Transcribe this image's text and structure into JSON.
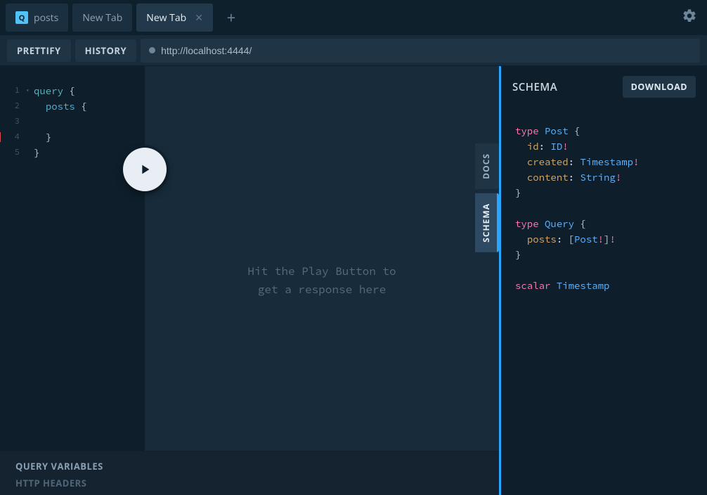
{
  "tabs": [
    {
      "badge": "Q",
      "label": "posts",
      "active": false,
      "closeable": false
    },
    {
      "badge": "",
      "label": "New Tab",
      "active": false,
      "closeable": false
    },
    {
      "badge": "",
      "label": "New Tab",
      "active": true,
      "closeable": true
    }
  ],
  "toolbar": {
    "prettify": "PRETTIFY",
    "history": "HISTORY",
    "url": "http://localhost:4444/"
  },
  "editor": {
    "lines": [
      {
        "n": "1",
        "fold": true,
        "err": false,
        "html": "<span class='kw-query'>query</span> <span class='brace'>{</span>"
      },
      {
        "n": "2",
        "fold": false,
        "err": false,
        "html": "  <span class='kw-field'>posts</span> <span class='brace'>{</span>"
      },
      {
        "n": "3",
        "fold": false,
        "err": false,
        "html": ""
      },
      {
        "n": "4",
        "fold": false,
        "err": true,
        "html": "  <span class='brace'>}</span>"
      },
      {
        "n": "5",
        "fold": false,
        "err": false,
        "html": "<span class='brace'>}</span>"
      }
    ]
  },
  "response": {
    "placeholder": "Hit the Play Button to\nget a response here"
  },
  "side_tabs": {
    "docs": "DOCS",
    "schema": "SCHEMA"
  },
  "schema_panel": {
    "title": "SCHEMA",
    "download": "DOWNLOAD",
    "sdl_html": "<span class='s-key'>type</span> <span class='s-type'>Post</span> <span class='s-punc'>{</span>\n  <span class='s-field'>id</span><span class='s-punc'>:</span> <span class='s-type'>ID</span><span class='s-bang'>!</span>\n  <span class='s-field'>created</span><span class='s-punc'>:</span> <span class='s-type'>Timestamp</span><span class='s-bang'>!</span>\n  <span class='s-field'>content</span><span class='s-punc'>:</span> <span class='s-type'>String</span><span class='s-bang'>!</span>\n<span class='s-punc'>}</span>\n\n<span class='s-key'>type</span> <span class='s-type'>Query</span> <span class='s-punc'>{</span>\n  <span class='s-field'>posts</span><span class='s-punc'>:</span> <span class='s-punc'>[</span><span class='s-type'>Post</span><span class='s-bang'>!</span><span class='s-punc'>]</span><span class='s-bang'>!</span>\n<span class='s-punc'>}</span>\n\n<span class='s-key'>scalar</span> <span class='s-scalar'>Timestamp</span>"
  },
  "bottom": {
    "query_variables": "QUERY VARIABLES",
    "http_headers": "HTTP HEADERS"
  }
}
